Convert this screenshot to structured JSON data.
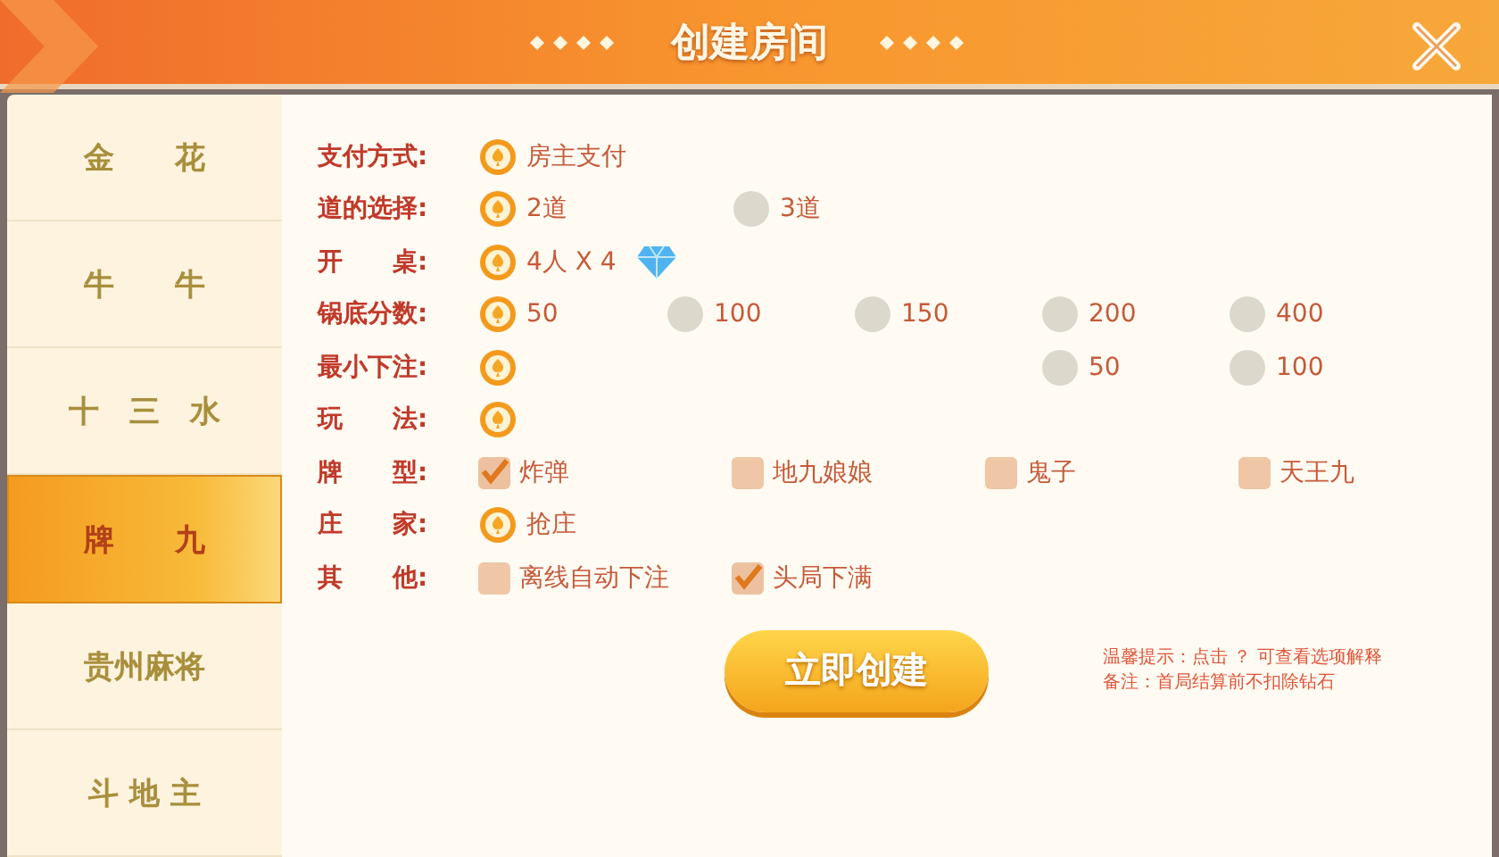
{
  "window": {
    "title": "创建房间"
  },
  "sidebar": {
    "items": [
      {
        "label": "金　　花",
        "selected": false
      },
      {
        "label": "牛　　牛",
        "selected": false
      },
      {
        "label": "十　三　水",
        "selected": false
      },
      {
        "label": "牌　　九",
        "selected": true
      },
      {
        "label": "贵州麻将",
        "selected": false
      },
      {
        "label": "斗 地 主",
        "selected": false
      }
    ]
  },
  "settings": [
    {
      "label": "支付方式:",
      "kind": "radio",
      "options": [
        {
          "label": "房主支付",
          "selected": true
        }
      ]
    },
    {
      "label": "道的选择:",
      "kind": "radio",
      "options": [
        {
          "label": "2道",
          "selected": true
        },
        {
          "label": "3道",
          "selected": false
        }
      ]
    },
    {
      "label": "开　　桌:",
      "kind": "radio-diamond",
      "options": [
        {
          "label": "4人 X 4",
          "selected": true
        }
      ]
    },
    {
      "label": "锅底分数:",
      "kind": "radio",
      "options": [
        {
          "label": "50",
          "selected": true
        },
        {
          "label": "100",
          "selected": false
        },
        {
          "label": "150",
          "selected": false
        },
        {
          "label": "200",
          "selected": false
        },
        {
          "label": "400",
          "selected": false
        }
      ]
    },
    {
      "label": "最小下注:",
      "kind": "radio",
      "options": [
        {
          "selected": true
        },
        {
          "label": "50",
          "selected": false
        },
        {
          "label": "100",
          "selected": false
        }
      ]
    },
    {
      "label": "玩　　法:",
      "kind": "radio",
      "options": [
        {
          "selected": true
        }
      ]
    },
    {
      "label": "牌　　型:",
      "kind": "check",
      "options": [
        {
          "label": "炸弹",
          "checked": true
        },
        {
          "label": "地九娘娘",
          "checked": false
        },
        {
          "label": "鬼子",
          "checked": false
        },
        {
          "label": "天王九",
          "checked": false
        }
      ]
    },
    {
      "label": "庄　　家:",
      "kind": "radio",
      "options": [
        {
          "label": "抢庄",
          "selected": true
        }
      ]
    },
    {
      "label": "其　　他:",
      "kind": "check",
      "options": [
        {
          "label": "离线自动下注",
          "checked": false
        },
        {
          "label": "头局下满",
          "checked": true
        }
      ]
    }
  ],
  "create_button": "立即创建",
  "notes": [
    "温馨提示：点击 ？ 可查看选项解释",
    "备注：首局结算前不扣除钻石"
  ]
}
